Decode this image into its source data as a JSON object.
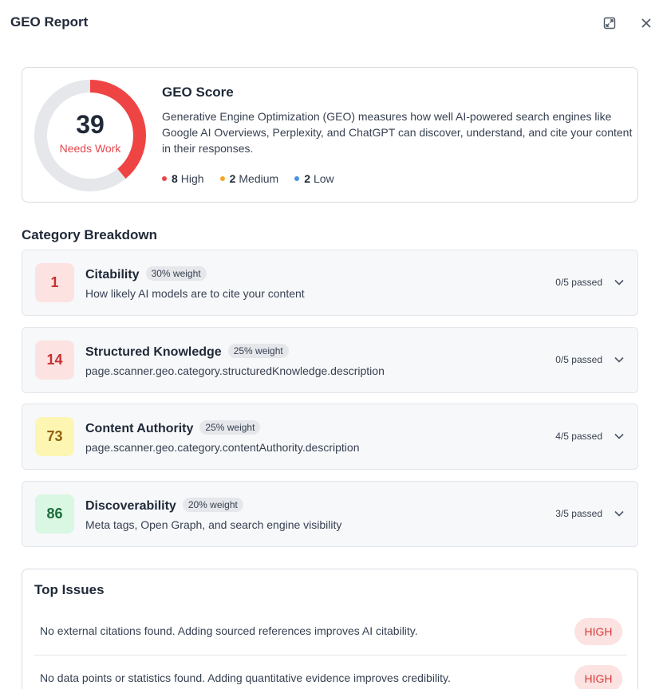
{
  "header": {
    "title": "GEO Report"
  },
  "score": {
    "value": "39",
    "fraction": 0.39,
    "status": "Needs Work",
    "title": "GEO Score",
    "description": "Generative Engine Optimization (GEO) measures how well AI-powered search engines like Google AI Overviews, Perplexity, and ChatGPT can discover, understand, and cite your content in their responses.",
    "accent_color": "#ef4444",
    "track_color": "#e5e7eb",
    "legend": [
      {
        "count": "8",
        "label": "High",
        "color": "#e5484d"
      },
      {
        "count": "2",
        "label": "Medium",
        "color": "#f5a524"
      },
      {
        "count": "2",
        "label": "Low",
        "color": "#4a90e2"
      }
    ]
  },
  "categories_title": "Category Breakdown",
  "categories": [
    {
      "score": "1",
      "name": "Citability",
      "weight": "30% weight",
      "description": "How likely AI models are to cite your content",
      "passed": "0/5 passed",
      "badge_bg": "#fde2e2",
      "badge_fg": "#c53030"
    },
    {
      "score": "14",
      "name": "Structured Knowledge",
      "weight": "25% weight",
      "description": "page.scanner.geo.category.structuredKnowledge.description",
      "passed": "0/5 passed",
      "badge_bg": "#fde2e2",
      "badge_fg": "#c53030"
    },
    {
      "score": "73",
      "name": "Content Authority",
      "weight": "25% weight",
      "description": "page.scanner.geo.category.contentAuthority.description",
      "passed": "4/5 passed",
      "badge_bg": "#fdf6b2",
      "badge_fg": "#92610e"
    },
    {
      "score": "86",
      "name": "Discoverability",
      "weight": "20% weight",
      "description": "Meta tags, Open Graph, and search engine visibility",
      "passed": "3/5 passed",
      "badge_bg": "#d9f7e3",
      "badge_fg": "#1d6b3a"
    }
  ],
  "issues": {
    "title": "Top Issues",
    "items": [
      {
        "text": "No external citations found. Adding sourced references improves AI citability.",
        "severity": "HIGH"
      },
      {
        "text": "No data points or statistics found. Adding quantitative evidence improves credibility.",
        "severity": "HIGH"
      }
    ]
  }
}
